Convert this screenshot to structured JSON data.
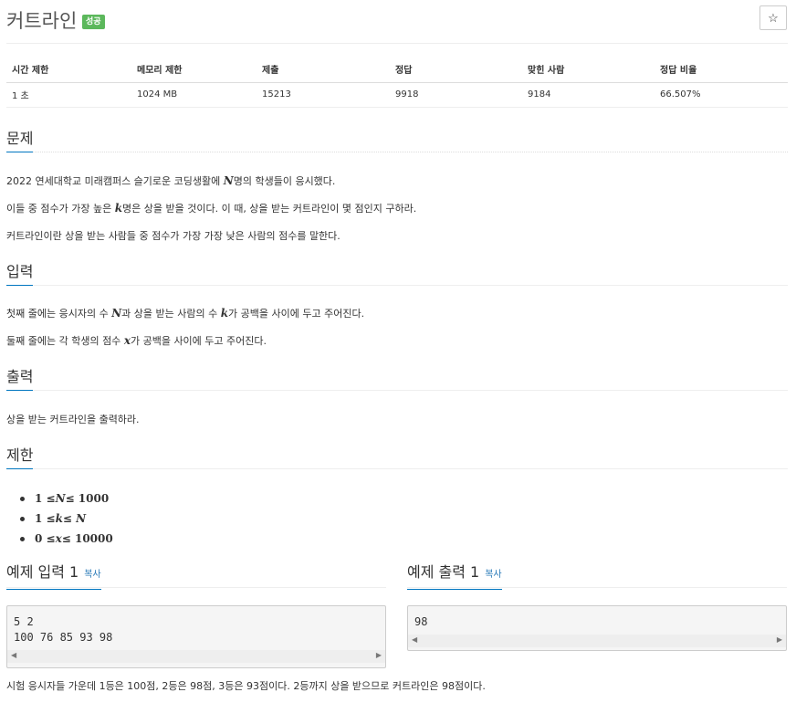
{
  "problem": {
    "title": "커트라인",
    "status_badge": "성공",
    "star_icon": "☆"
  },
  "info_table": {
    "headers": [
      "시간 제한",
      "메모리 제한",
      "제출",
      "정답",
      "맞힌 사람",
      "정답 비율"
    ],
    "values": [
      "1 초",
      "1024 MB",
      "15213",
      "9918",
      "9184",
      "66.507%"
    ]
  },
  "sections": {
    "description": {
      "title": "문제",
      "line1_pre": "2022 연세대학교 미래캠퍼스 슬기로운 코딩생활에 ",
      "line1_var": "N",
      "line1_post": "명의 학생들이 응시했다.",
      "line2_pre": "이들 중 점수가 가장 높은 ",
      "line2_var": "k",
      "line2_post": "명은 상을 받을 것이다. 이 때, 상을 받는 커트라인이 몇 점인지 구하라.",
      "line3": "커트라인이란 상을 받는 사람들 중 점수가 가장 가장 낮은 사람의 점수를 말한다."
    },
    "input": {
      "title": "입력",
      "line1_pre": "첫째 줄에는 응시자의 수 ",
      "line1_var1": "N",
      "line1_mid": "과 상을 받는 사람의 수 ",
      "line1_var2": "k",
      "line1_post": "가 공백을 사이에 두고 주어진다.",
      "line2_pre": "둘째 줄에는 각 학생의 점수 ",
      "line2_var": "x",
      "line2_post": "가 공백을 사이에 두고 주어진다."
    },
    "output": {
      "title": "출력",
      "line1": "상을 받는 커트라인을 출력하라."
    },
    "limits": {
      "title": "제한",
      "items": [
        {
          "lo": "1 ≤ ",
          "var": "N",
          "hi": " ≤ 1000"
        },
        {
          "lo": "1 ≤ ",
          "var": "k",
          "hi": " ≤ N"
        },
        {
          "lo": "0 ≤ ",
          "var": "x",
          "hi": " ≤ 10000"
        }
      ]
    }
  },
  "examples": {
    "input_title": "예제 입력 1",
    "output_title": "예제 출력 1",
    "copy_label": "복사",
    "input_text": "5 2\n100 76 85 93 98",
    "output_text": "98"
  },
  "note": "시험 응시자들 가운데 1등은 100점, 2등은 98점, 3등은 93점이다. 2등까지 상을 받으므로 커트라인은 98점이다."
}
